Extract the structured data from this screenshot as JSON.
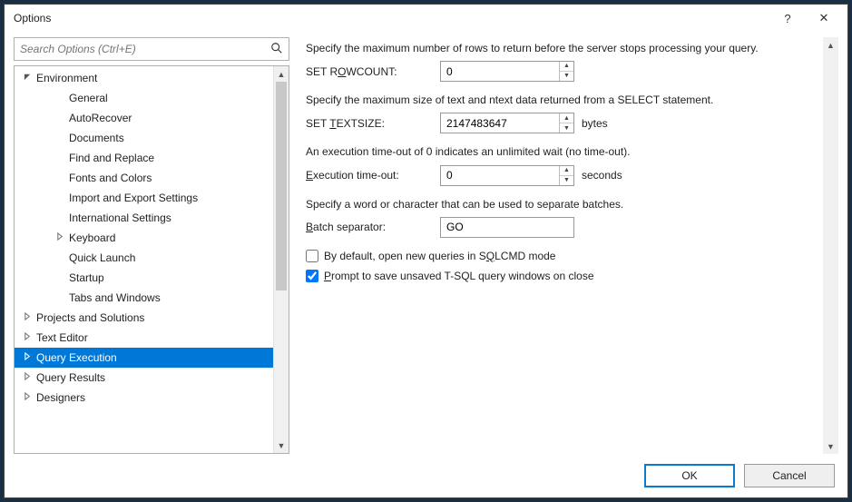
{
  "window": {
    "title": "Options",
    "help": "?",
    "close": "✕"
  },
  "search": {
    "placeholder": "Search Options (Ctrl+E)"
  },
  "tree": [
    {
      "label": "Environment",
      "depth": 0,
      "exp": "down",
      "sel": false
    },
    {
      "label": "General",
      "depth": 1,
      "exp": "",
      "sel": false
    },
    {
      "label": "AutoRecover",
      "depth": 1,
      "exp": "",
      "sel": false
    },
    {
      "label": "Documents",
      "depth": 1,
      "exp": "",
      "sel": false
    },
    {
      "label": "Find and Replace",
      "depth": 1,
      "exp": "",
      "sel": false
    },
    {
      "label": "Fonts and Colors",
      "depth": 1,
      "exp": "",
      "sel": false
    },
    {
      "label": "Import and Export Settings",
      "depth": 1,
      "exp": "",
      "sel": false
    },
    {
      "label": "International Settings",
      "depth": 1,
      "exp": "",
      "sel": false
    },
    {
      "label": "Keyboard",
      "depth": 1,
      "exp": "right",
      "sel": false
    },
    {
      "label": "Quick Launch",
      "depth": 1,
      "exp": "",
      "sel": false
    },
    {
      "label": "Startup",
      "depth": 1,
      "exp": "",
      "sel": false
    },
    {
      "label": "Tabs and Windows",
      "depth": 1,
      "exp": "",
      "sel": false
    },
    {
      "label": "Projects and Solutions",
      "depth": 0,
      "exp": "right",
      "sel": false
    },
    {
      "label": "Text Editor",
      "depth": 0,
      "exp": "right",
      "sel": false
    },
    {
      "label": "Query Execution",
      "depth": 0,
      "exp": "right",
      "sel": true
    },
    {
      "label": "Query Results",
      "depth": 0,
      "exp": "right",
      "sel": false
    },
    {
      "label": "Designers",
      "depth": 0,
      "exp": "right",
      "sel": false
    }
  ],
  "content": {
    "p1": "Specify the maximum number of rows to return before the server stops processing your query.",
    "rowcount_lbl_pre": "SET R",
    "rowcount_lbl_u": "O",
    "rowcount_lbl_post": "WCOUNT:",
    "rowcount_val": "0",
    "p2": "Specify the maximum size of text and ntext data returned from a SELECT statement.",
    "textsize_lbl_pre": "SET ",
    "textsize_lbl_u": "T",
    "textsize_lbl_post": "EXTSIZE:",
    "textsize_val": "2147483647",
    "textsize_unit": "bytes",
    "p3": "An execution time-out of 0 indicates an unlimited wait (no time-out).",
    "timeout_lbl_u": "E",
    "timeout_lbl_post": "xecution time-out:",
    "timeout_val": "0",
    "timeout_unit": "seconds",
    "p4": "Specify a word or character that can be used to separate batches.",
    "batch_lbl_u": "B",
    "batch_lbl_post": "atch separator:",
    "batch_val": "GO",
    "cb1_pre": "By default, open new queries in S",
    "cb1_u": "Q",
    "cb1_post": "LCMD mode",
    "cb1_checked": false,
    "cb2_u": "P",
    "cb2_post": "rompt to save unsaved T-SQL query windows on close",
    "cb2_checked": true
  },
  "footer": {
    "ok": "OK",
    "cancel": "Cancel"
  }
}
